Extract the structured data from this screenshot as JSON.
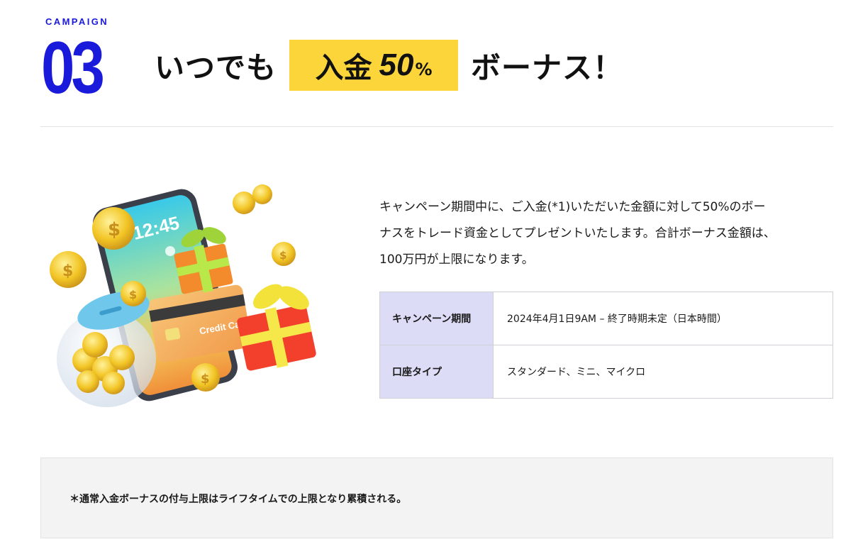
{
  "header": {
    "campaign_label": "CAMPAIGN",
    "campaign_number": "03",
    "headline_pre": "いつでも",
    "highlight_text": "入金",
    "highlight_number": "50",
    "highlight_unit": "%",
    "headline_post": "ボーナス！"
  },
  "illustration": {
    "phone_time": "12:45",
    "card_text": "Credit Ca"
  },
  "description": {
    "lines": [
      "キャンペーン期間中に、ご入金(*1)いただいた金額に対して50%のボー",
      "ナスをトレード資金としてプレゼントいたします。合計ボーナス金額は、",
      "100万円が上限になります。"
    ]
  },
  "info_table": {
    "rows": [
      {
        "label": "キャンペーン期間",
        "value": "2024年4月1日9AM – 終了時期未定（日本時間）"
      },
      {
        "label": "口座タイプ",
        "value": "スタンダード、ミニ、マイクロ"
      }
    ]
  },
  "note": {
    "text": "＊通常入金ボーナスの付与上限はライフタイムでの上限となり累積される。"
  },
  "colors": {
    "accent_blue": "#1a1adb",
    "highlight_yellow": "#fcd53a",
    "table_header_bg": "#dcdcf7",
    "note_bg": "#f3f3f3"
  }
}
